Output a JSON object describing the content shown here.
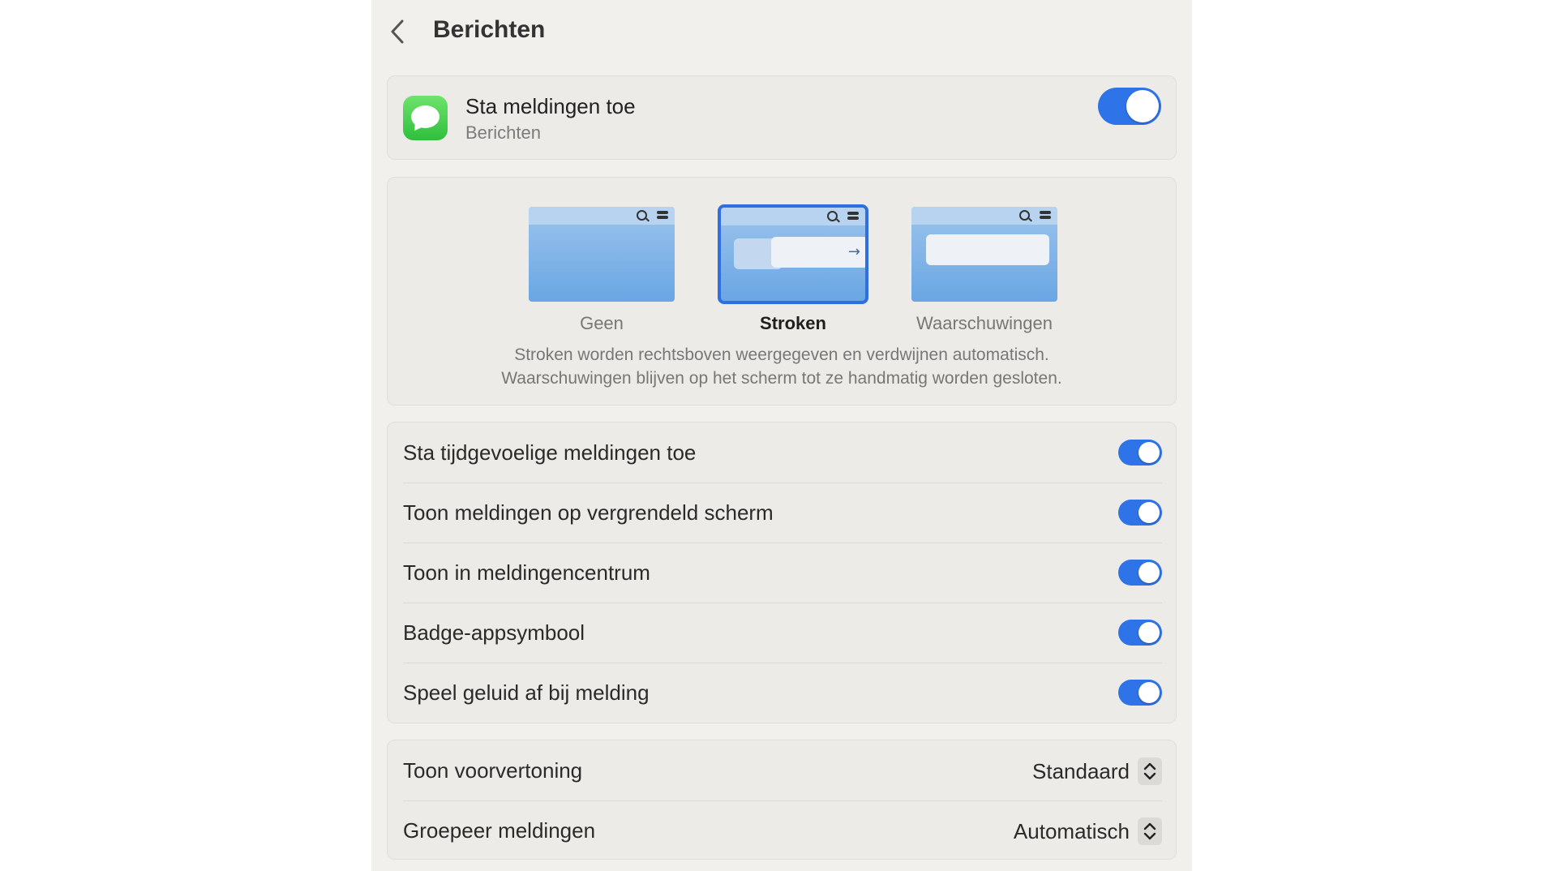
{
  "header": {
    "title": "Berichten"
  },
  "allow_card": {
    "title": "Sta meldingen toe",
    "subtitle": "Berichten",
    "enabled": true
  },
  "alert_style": {
    "options": [
      {
        "label": "Geen",
        "selected": false
      },
      {
        "label": "Stroken",
        "selected": true
      },
      {
        "label": "Waarschuwingen",
        "selected": false
      }
    ],
    "description_line1": "Stroken worden rechtsboven weergegeven en verdwijnen automatisch.",
    "description_line2": "Waarschuwingen blijven op het scherm tot ze handmatig worden gesloten."
  },
  "toggles": [
    {
      "label": "Sta tijdgevoelige meldingen toe",
      "on": true
    },
    {
      "label": "Toon meldingen op vergrendeld scherm",
      "on": true
    },
    {
      "label": "Toon in meldingencentrum",
      "on": true
    },
    {
      "label": "Badge-appsymbool",
      "on": true
    },
    {
      "label": "Speel geluid af bij melding",
      "on": true
    }
  ],
  "popups": [
    {
      "label": "Toon voorvertoning",
      "value": "Standaard"
    },
    {
      "label": "Groepeer meldingen",
      "value": "Automatisch"
    }
  ],
  "colors": {
    "accent": "#2f73e8",
    "panel_bg": "#f2f0ec",
    "card_bg": "#ecebe7"
  },
  "icons": {
    "back": "chevron-left-icon",
    "app": "messages-app-icon",
    "popup": "chevron-up-down-icon"
  }
}
